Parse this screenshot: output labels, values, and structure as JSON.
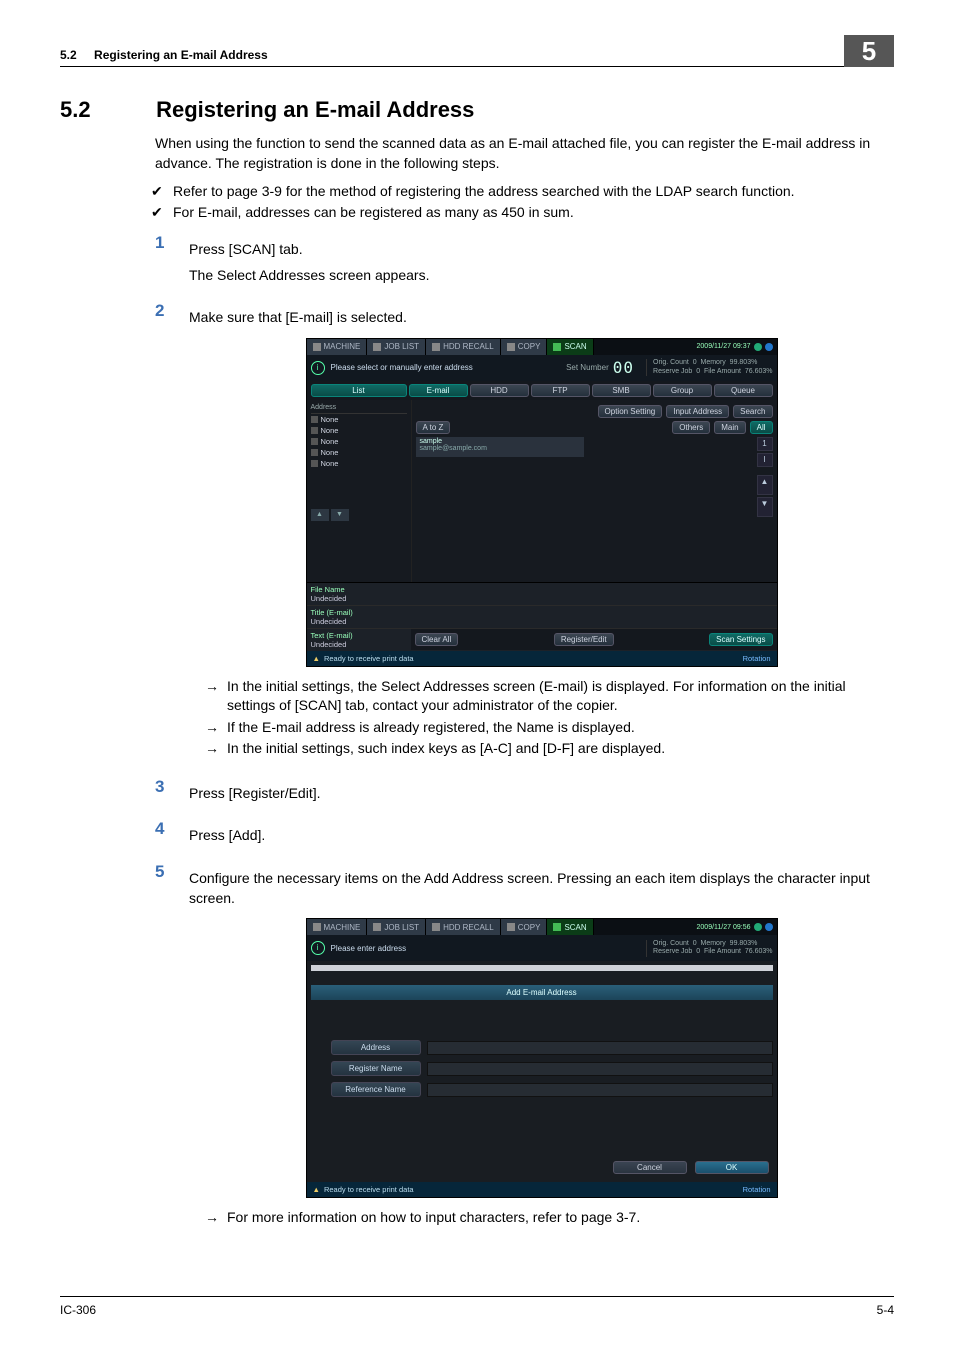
{
  "header": {
    "section_number": "5.2",
    "section_title_running": "Registering an E-mail Address",
    "chapter_tab": "5"
  },
  "title": {
    "num": "5.2",
    "text": "Registering an E-mail Address"
  },
  "intro": "When using the function to send the scanned data as an E-mail attached file, you can register the E-mail address in advance.  The registration is done in the following steps.",
  "checks": [
    "Refer to page 3-9 for the method of registering the address searched with the LDAP search function.",
    "For E-mail, addresses can be registered as many as 450 in sum."
  ],
  "steps": {
    "1": {
      "text": "Press [SCAN] tab.",
      "after": "The Select Addresses screen appears."
    },
    "2": {
      "text": "Make sure that [E-mail] is selected.",
      "arrows": [
        "In the initial settings, the Select Addresses screen (E-mail) is displayed.  For information on the initial settings of [SCAN] tab, contact your administrator of the copier.",
        "If the E-mail address is already registered, the Name is displayed.",
        "In the initial settings, such index keys as [A-C] and [D-F] are displayed."
      ]
    },
    "3": {
      "text": "Press [Register/Edit]."
    },
    "4": {
      "text": "Press [Add]."
    },
    "5": {
      "text": "Configure the necessary items on the Add Address screen.  Pressing an each item displays the character input screen.",
      "arrows": [
        "For more information on how to input characters, refer to page 3-7."
      ]
    }
  },
  "screenshot1": {
    "top_tabs": [
      "MACHINE",
      "JOB LIST",
      "HDD RECALL",
      "COPY",
      "SCAN"
    ],
    "timestamp": "2009/11/27 09:37",
    "info_msg": "Please select or manually enter address",
    "set_number_label": "Set Number",
    "set_number_value": "00",
    "meter": {
      "orig_count_label": "Orig. Count",
      "orig_count_val": "0",
      "reserve_label": "Reserve Job",
      "reserve_val": "0",
      "memory_label": "Memory",
      "memory_val": "99.803%",
      "file_label": "File Amount",
      "file_val": "76.603%"
    },
    "side_list_btn": "List",
    "type_tabs": [
      "E-mail",
      "HDD",
      "FTP",
      "SMB",
      "Group",
      "Queue"
    ],
    "action_btns": [
      "Option Setting",
      "Input Address",
      "Search"
    ],
    "filter_btns": [
      "A to Z",
      "Others",
      "Main",
      "All"
    ],
    "side": {
      "hdr": "Address",
      "rows": [
        "None",
        "None",
        "None",
        "None",
        "None"
      ]
    },
    "entry": {
      "name": "sample",
      "addr": "sample@sample.com"
    },
    "botfields": {
      "file_name_label": "File Name",
      "file_name_val": "Undecided",
      "title_label": "Title (E-mail)",
      "title_val": "Undecided",
      "text_label": "Text (E-mail)",
      "text_val": "Undecided"
    },
    "bot_buttons": {
      "clear": "Clear All",
      "reg": "Register/Edit",
      "scan": "Scan Settings"
    },
    "status": "Ready to receive print data",
    "rotation": "Rotation"
  },
  "screenshot2": {
    "top_tabs": [
      "MACHINE",
      "JOB LIST",
      "HDD RECALL",
      "COPY",
      "SCAN"
    ],
    "timestamp": "2009/11/27 09:56",
    "info_msg": "Please enter address",
    "meter": {
      "orig_count_label": "Orig. Count",
      "orig_count_val": "0",
      "reserve_label": "Reserve Job",
      "reserve_val": "0",
      "memory_label": "Memory",
      "memory_val": "99.803%",
      "file_label": "File Amount",
      "file_val": "76.603%"
    },
    "titlebar": "Add E-mail Address",
    "fields": [
      "Address",
      "Register Name",
      "Reference Name"
    ],
    "cancel": "Cancel",
    "ok": "OK",
    "status": "Ready to receive print data",
    "rotation": "Rotation"
  },
  "footer": {
    "left": "IC-306",
    "right": "5-4"
  }
}
